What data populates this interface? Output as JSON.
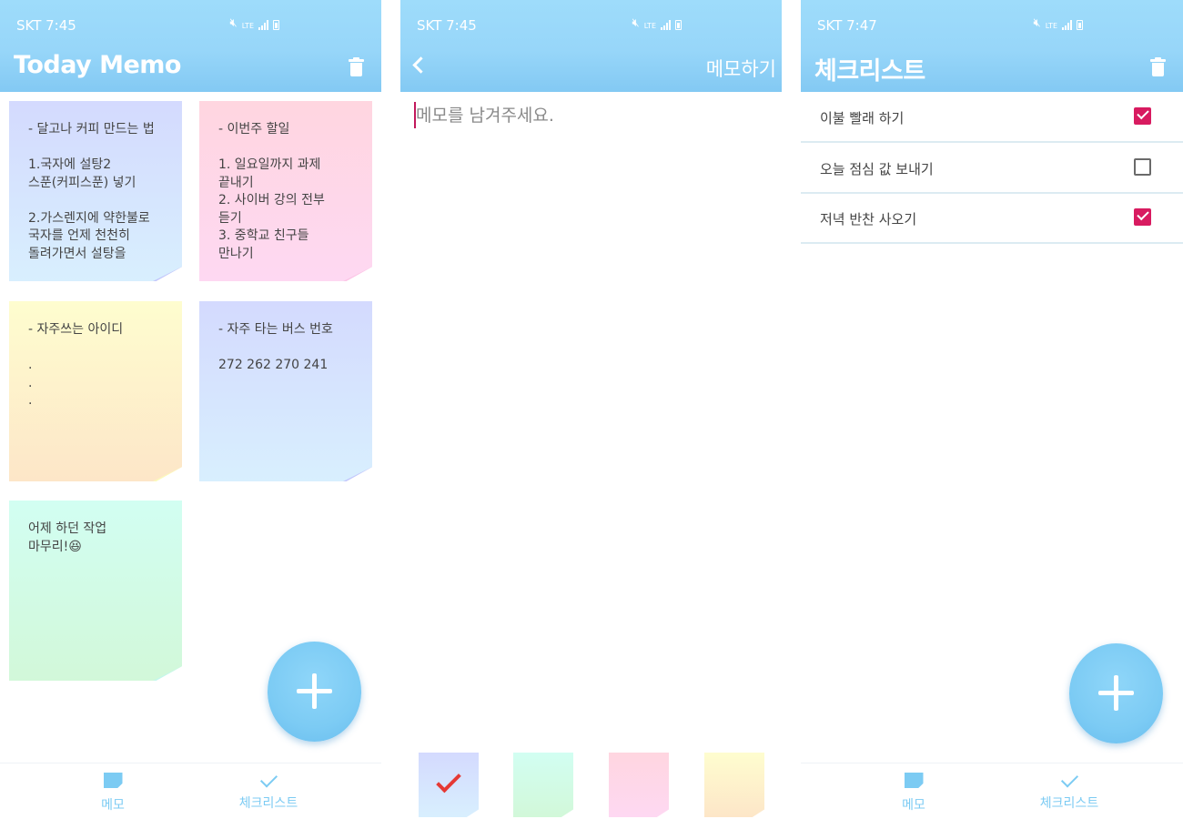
{
  "colors": {
    "appbar": "#97d6f9",
    "accent": "#7ccbf3",
    "checkbox_checked": "#d81b60",
    "caret": "#c2185b"
  },
  "screen1": {
    "status_time": "SKT 7:45",
    "title": "Today Memo",
    "notes": [
      {
        "color": "blue",
        "text": "- 달고나 커피 만드는 법\n\n1.국자에 설탕2\n스푼(커피스푼) 넣기\n\n2.가스렌지에 약한불로\n국자를 언제 천천히\n돌려가면서 설탕을"
      },
      {
        "color": "pink",
        "text": "- 이번주 할일\n\n1. 일요일까지 과제\n끝내기\n2. 사이버 강의 전부\n듣기\n3. 중학교 친구들\n만나기"
      },
      {
        "color": "yellow",
        "text": "- 자주쓰는 아이디\n\n.\n.\n."
      },
      {
        "color": "blue",
        "text": "- 자주 타는 버스 번호\n\n272  262  270  241"
      },
      {
        "color": "green",
        "text": "어제 하던 작업\n마무리!😆"
      }
    ],
    "nav": {
      "memo_label": "메모",
      "checklist_label": "체크리스트"
    }
  },
  "screen2": {
    "status_time": "SKT 7:45",
    "action_label": "메모하기",
    "input_placeholder": "메모를 남겨주세요.",
    "input_value": "",
    "swatches": [
      {
        "color": "blue",
        "selected": true
      },
      {
        "color": "green",
        "selected": false
      },
      {
        "color": "pink",
        "selected": false
      },
      {
        "color": "yellow",
        "selected": false
      }
    ]
  },
  "screen3": {
    "status_time": "SKT 7:47",
    "title": "체크리스트",
    "items": [
      {
        "label": "이불 빨래 하기",
        "checked": true
      },
      {
        "label": "오늘 점심 값 보내기",
        "checked": false
      },
      {
        "label": "저녁 반찬 사오기",
        "checked": true
      }
    ],
    "nav": {
      "memo_label": "메모",
      "checklist_label": "체크리스트"
    }
  },
  "icons": [
    "mute-icon",
    "lte-icon",
    "signal-icon",
    "battery-icon",
    "trash-icon",
    "back-icon",
    "add-icon",
    "memo-icon",
    "check-icon",
    "checkmark-icon"
  ]
}
